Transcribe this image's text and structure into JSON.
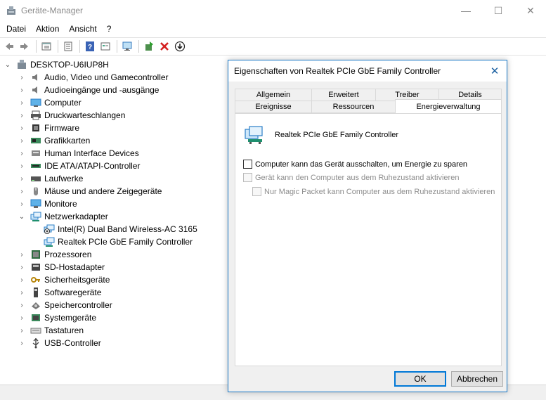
{
  "window": {
    "title": "Geräte-Manager",
    "controls": {
      "minimize": "—",
      "maximize": "☐",
      "close": "✕"
    }
  },
  "menu": [
    "Datei",
    "Aktion",
    "Ansicht",
    "?"
  ],
  "toolbar": {
    "icons": [
      "back-arrow-icon",
      "forward-arrow-icon",
      "properties-icon",
      "list-view-icon",
      "help-icon",
      "properties-sheet-icon",
      "monitor-scan-icon",
      "update-driver-icon",
      "uninstall-icon",
      "download-icon"
    ]
  },
  "tree": {
    "root": "DESKTOP-U6IUP8H",
    "items": [
      {
        "label": "Audio, Video und Gamecontroller",
        "icon": "speaker-icon",
        "expanded": false
      },
      {
        "label": "Audioeingänge und -ausgänge",
        "icon": "speaker-icon",
        "expanded": false
      },
      {
        "label": "Computer",
        "icon": "computer-icon",
        "expanded": false
      },
      {
        "label": "Druckwarteschlangen",
        "icon": "printer-icon",
        "expanded": false
      },
      {
        "label": "Firmware",
        "icon": "chip-icon",
        "expanded": false
      },
      {
        "label": "Grafikkarten",
        "icon": "display-adapter-icon",
        "expanded": false
      },
      {
        "label": "Human Interface Devices",
        "icon": "hid-icon",
        "expanded": false
      },
      {
        "label": "IDE ATA/ATAPI-Controller",
        "icon": "ide-icon",
        "expanded": false
      },
      {
        "label": "Laufwerke",
        "icon": "drive-icon",
        "expanded": false
      },
      {
        "label": "Mäuse und andere Zeigegeräte",
        "icon": "mouse-icon",
        "expanded": false
      },
      {
        "label": "Monitore",
        "icon": "monitor-icon",
        "expanded": false
      },
      {
        "label": "Netzwerkadapter",
        "icon": "network-icon",
        "expanded": true,
        "children": [
          {
            "label": "Intel(R) Dual Band Wireless-AC 3165",
            "icon": "network-disabled-icon"
          },
          {
            "label": "Realtek PCIe GbE Family Controller",
            "icon": "network-icon"
          }
        ]
      },
      {
        "label": "Prozessoren",
        "icon": "cpu-icon",
        "expanded": false
      },
      {
        "label": "SD-Hostadapter",
        "icon": "sd-icon",
        "expanded": false
      },
      {
        "label": "Sicherheitsgeräte",
        "icon": "key-icon",
        "expanded": false
      },
      {
        "label": "Softwaregeräte",
        "icon": "software-device-icon",
        "expanded": false
      },
      {
        "label": "Speichercontroller",
        "icon": "storage-icon",
        "expanded": false
      },
      {
        "label": "Systemgeräte",
        "icon": "system-device-icon",
        "expanded": false
      },
      {
        "label": "Tastaturen",
        "icon": "keyboard-icon",
        "expanded": false
      },
      {
        "label": "USB-Controller",
        "icon": "usb-icon",
        "expanded": false
      }
    ]
  },
  "dialog": {
    "title": "Eigenschaften von Realtek PCIe GbE Family Controller",
    "close": "✕",
    "tabs_row1": [
      "Allgemein",
      "Erweitert",
      "Treiber",
      "Details"
    ],
    "tabs_row2": [
      "Ereignisse",
      "Ressourcen",
      "Energieverwaltung"
    ],
    "active_tab": "Energieverwaltung",
    "device_name": "Realtek PCIe GbE Family Controller",
    "options": [
      {
        "label": "Computer kann das Gerät ausschalten, um Energie zu sparen",
        "checked": false,
        "enabled": true
      },
      {
        "label": "Gerät kann den Computer aus dem Ruhezustand aktivieren",
        "checked": false,
        "enabled": false
      },
      {
        "label": "Nur Magic Packet kann Computer aus dem Ruhezustand aktivieren",
        "checked": false,
        "enabled": false
      }
    ],
    "ok_label": "OK",
    "cancel_label": "Abbrechen"
  },
  "colors": {
    "accent": "#0078d7",
    "dialog_border": "#1a79c7",
    "disabled_text": "#8d8d8d"
  }
}
